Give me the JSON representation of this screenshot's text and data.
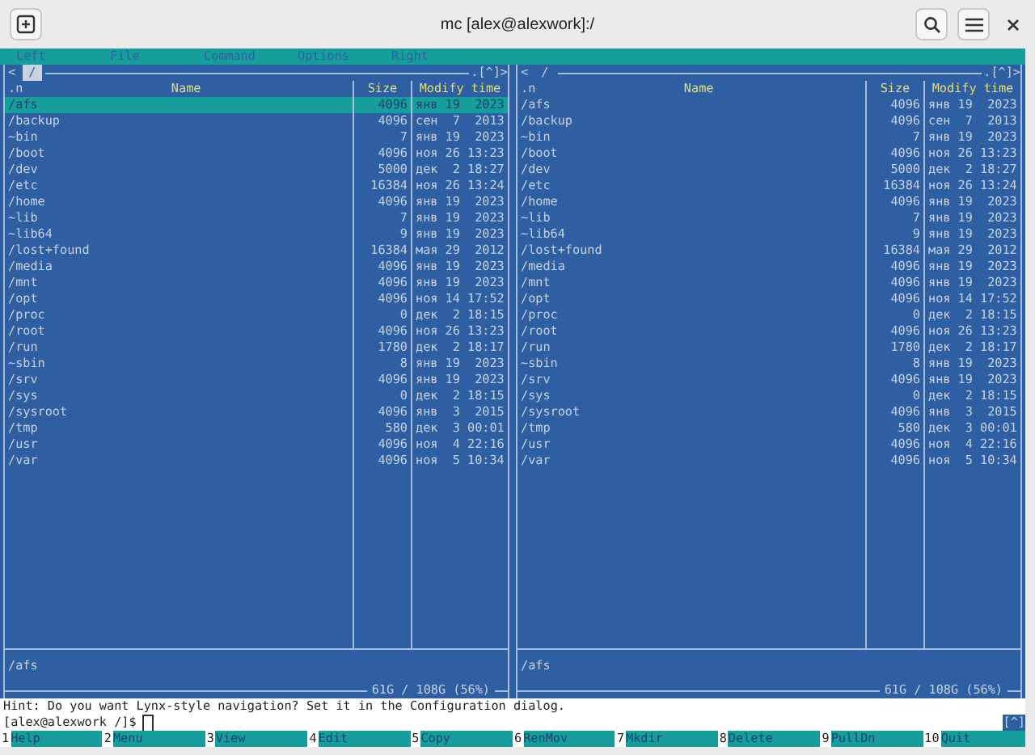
{
  "window": {
    "title": "mc [alex@alexwork]:/"
  },
  "menu": [
    {
      "label": "Left"
    },
    {
      "label": "File"
    },
    {
      "label": "Command"
    },
    {
      "label": "Options"
    },
    {
      "label": "Right"
    }
  ],
  "panels": [
    {
      "path": "/",
      "active": true,
      "corner": ".[^]>",
      "back": "<",
      "sort": ".n",
      "columns": [
        "Name",
        "Size",
        "Modify time"
      ],
      "status": "/afs",
      "disk": "61G / 108G (56%)",
      "rows": [
        {
          "name": "/afs",
          "size": "4096",
          "date": "янв 19  2023",
          "selected": true
        },
        {
          "name": "/backup",
          "size": "4096",
          "date": "сен  7  2013",
          "selected": false
        },
        {
          "name": "~bin",
          "size": "7",
          "date": "янв 19  2023",
          "selected": false
        },
        {
          "name": "/boot",
          "size": "4096",
          "date": "ноя 26 13:23",
          "selected": false
        },
        {
          "name": "/dev",
          "size": "5000",
          "date": "дек  2 18:27",
          "selected": false
        },
        {
          "name": "/etc",
          "size": "16384",
          "date": "ноя 26 13:24",
          "selected": false
        },
        {
          "name": "/home",
          "size": "4096",
          "date": "янв 19  2023",
          "selected": false
        },
        {
          "name": "~lib",
          "size": "7",
          "date": "янв 19  2023",
          "selected": false
        },
        {
          "name": "~lib64",
          "size": "9",
          "date": "янв 19  2023",
          "selected": false
        },
        {
          "name": "/lost+found",
          "size": "16384",
          "date": "мая 29  2012",
          "selected": false
        },
        {
          "name": "/media",
          "size": "4096",
          "date": "янв 19  2023",
          "selected": false
        },
        {
          "name": "/mnt",
          "size": "4096",
          "date": "янв 19  2023",
          "selected": false
        },
        {
          "name": "/opt",
          "size": "4096",
          "date": "ноя 14 17:52",
          "selected": false
        },
        {
          "name": "/proc",
          "size": "0",
          "date": "дек  2 18:15",
          "selected": false
        },
        {
          "name": "/root",
          "size": "4096",
          "date": "ноя 26 13:23",
          "selected": false
        },
        {
          "name": "/run",
          "size": "1780",
          "date": "дек  2 18:17",
          "selected": false
        },
        {
          "name": "~sbin",
          "size": "8",
          "date": "янв 19  2023",
          "selected": false
        },
        {
          "name": "/srv",
          "size": "4096",
          "date": "янв 19  2023",
          "selected": false
        },
        {
          "name": "/sys",
          "size": "0",
          "date": "дек  2 18:15",
          "selected": false
        },
        {
          "name": "/sysroot",
          "size": "4096",
          "date": "янв  3  2015",
          "selected": false
        },
        {
          "name": "/tmp",
          "size": "580",
          "date": "дек  3 00:01",
          "selected": false
        },
        {
          "name": "/usr",
          "size": "4096",
          "date": "ноя  4 22:16",
          "selected": false
        },
        {
          "name": "/var",
          "size": "4096",
          "date": "ноя  5 10:34",
          "selected": false
        }
      ]
    },
    {
      "path": "/",
      "active": false,
      "corner": ".[^]>",
      "back": "<",
      "sort": ".n",
      "columns": [
        "Name",
        "Size",
        "Modify time"
      ],
      "status": "/afs",
      "disk": "61G / 108G (56%)",
      "rows": [
        {
          "name": "/afs",
          "size": "4096",
          "date": "янв 19  2023",
          "selected": false
        },
        {
          "name": "/backup",
          "size": "4096",
          "date": "сен  7  2013",
          "selected": false
        },
        {
          "name": "~bin",
          "size": "7",
          "date": "янв 19  2023",
          "selected": false
        },
        {
          "name": "/boot",
          "size": "4096",
          "date": "ноя 26 13:23",
          "selected": false
        },
        {
          "name": "/dev",
          "size": "5000",
          "date": "дек  2 18:27",
          "selected": false
        },
        {
          "name": "/etc",
          "size": "16384",
          "date": "ноя 26 13:24",
          "selected": false
        },
        {
          "name": "/home",
          "size": "4096",
          "date": "янв 19  2023",
          "selected": false
        },
        {
          "name": "~lib",
          "size": "7",
          "date": "янв 19  2023",
          "selected": false
        },
        {
          "name": "~lib64",
          "size": "9",
          "date": "янв 19  2023",
          "selected": false
        },
        {
          "name": "/lost+found",
          "size": "16384",
          "date": "мая 29  2012",
          "selected": false
        },
        {
          "name": "/media",
          "size": "4096",
          "date": "янв 19  2023",
          "selected": false
        },
        {
          "name": "/mnt",
          "size": "4096",
          "date": "янв 19  2023",
          "selected": false
        },
        {
          "name": "/opt",
          "size": "4096",
          "date": "ноя 14 17:52",
          "selected": false
        },
        {
          "name": "/proc",
          "size": "0",
          "date": "дек  2 18:15",
          "selected": false
        },
        {
          "name": "/root",
          "size": "4096",
          "date": "ноя 26 13:23",
          "selected": false
        },
        {
          "name": "/run",
          "size": "1780",
          "date": "дек  2 18:17",
          "selected": false
        },
        {
          "name": "~sbin",
          "size": "8",
          "date": "янв 19  2023",
          "selected": false
        },
        {
          "name": "/srv",
          "size": "4096",
          "date": "янв 19  2023",
          "selected": false
        },
        {
          "name": "/sys",
          "size": "0",
          "date": "дек  2 18:15",
          "selected": false
        },
        {
          "name": "/sysroot",
          "size": "4096",
          "date": "янв  3  2015",
          "selected": false
        },
        {
          "name": "/tmp",
          "size": "580",
          "date": "дек  3 00:01",
          "selected": false
        },
        {
          "name": "/usr",
          "size": "4096",
          "date": "ноя  4 22:16",
          "selected": false
        },
        {
          "name": "/var",
          "size": "4096",
          "date": "ноя  5 10:34",
          "selected": false
        }
      ]
    }
  ],
  "hint": "Hint: Do you want Lynx-style navigation? Set it in the Configuration dialog.",
  "prompt": "[alex@alexwork /]$",
  "history_button": "[^]",
  "function_keys": [
    {
      "key": "1",
      "label": "Help"
    },
    {
      "key": "2",
      "label": "Menu"
    },
    {
      "key": "3",
      "label": "View"
    },
    {
      "key": "4",
      "label": "Edit"
    },
    {
      "key": "5",
      "label": "Copy"
    },
    {
      "key": "6",
      "label": "RenMov"
    },
    {
      "key": "7",
      "label": "Mkdir"
    },
    {
      "key": "8",
      "label": "Delete"
    },
    {
      "key": "9",
      "label": "PullDn"
    },
    {
      "key": "10",
      "label": "Quit"
    }
  ]
}
